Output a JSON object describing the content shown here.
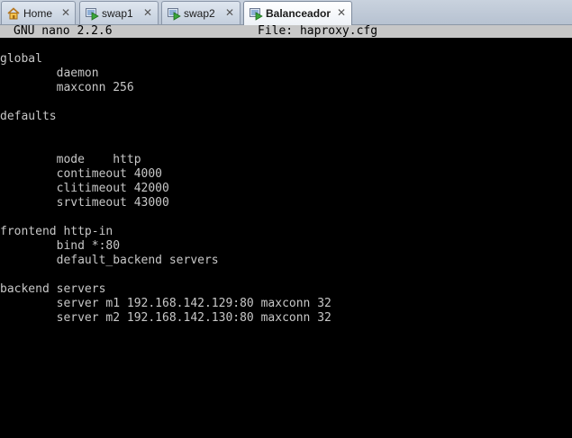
{
  "tabs": [
    {
      "label": "Home",
      "icon": "home-icon",
      "active": false
    },
    {
      "label": "swap1",
      "icon": "vm-play-icon",
      "active": false
    },
    {
      "label": "swap2",
      "icon": "vm-play-icon",
      "active": false
    },
    {
      "label": "Balanceador",
      "icon": "vm-play-icon",
      "active": true
    }
  ],
  "close_glyph": "✕",
  "editor": {
    "version": "GNU nano 2.2.6",
    "file": "File: haproxy.cfg"
  },
  "buffer_lines": [
    "global",
    "        daemon",
    "        maxconn 256",
    "",
    "defaults",
    "",
    "",
    "        mode    http",
    "        contimeout 4000",
    "        clitimeout 42000",
    "        srvtimeout 43000",
    "",
    "frontend http-in",
    "        bind *:80",
    "        default_backend servers",
    "",
    "backend servers",
    "        server m1 192.168.142.129:80 maxconn 32",
    "        server m2 192.168.142.130:80 maxconn 32"
  ],
  "colors": {
    "terminal_bg": "#000000",
    "terminal_fg": "#c7c7c7",
    "header_bg": "#c7c7c7",
    "vm_icon_green": "#3aa63a"
  }
}
